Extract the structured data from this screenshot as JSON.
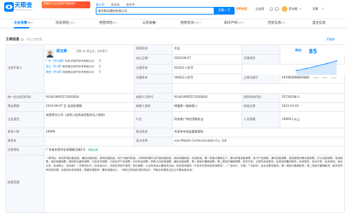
{
  "header": {
    "logo_text": "天眼查",
    "logo_url": "TianYanCha.com",
    "banner_text": "国家中小企业发展子基金旗下",
    "search_tabs": [
      "查公司",
      "查老板",
      "查关系"
    ],
    "search_value": "维沃移动通信有限公司",
    "search_button": "天眼一下",
    "vip_label": "VIP会员",
    "enterprise_label": "企业版",
    "user_name": "西瓜橙",
    "more_label": "天眼",
    "colors": {
      "brand": "#0084ff",
      "vip": "#ff7a00",
      "banner": "#ff5a30"
    }
  },
  "nav": {
    "tabs": [
      {
        "label": "企业背景",
        "count": "99+"
      },
      {
        "label": "司法风险",
        "count": "999+"
      },
      {
        "label": "经营风险",
        "count": "99+"
      },
      {
        "label": "公司发展",
        "count": "7"
      },
      {
        "label": "经营状况",
        "count": "999+"
      },
      {
        "label": "知识产权",
        "count": "999+"
      },
      {
        "label": "历史信息",
        "count": "99+"
      },
      {
        "label": "自主信息",
        "count": ""
      }
    ],
    "active_index": 0
  },
  "section": {
    "title": "工商信息",
    "subtitle": "历史工商信息",
    "right_label": "天眼查"
  },
  "legal_rep": {
    "label": "法定代表人",
    "name": "胡玉荣",
    "info": "任职 58 家企业，分布如下",
    "regions": [
      {
        "tag": "广东（共58家）",
        "text": "广东科讯软件技术有限公司",
        "more": "等"
      },
      {
        "tag": "浙江（共1家）",
        "text": "南京维沃软件技术有限公司",
        "more": "等"
      },
      {
        "tag": "其他（共4家）",
        "text": "西安维沃软件技术有限公司",
        "more": "等"
      }
    ]
  },
  "score": {
    "label": "评分",
    "value": "85",
    "years": [
      "2018",
      "2019",
      "2020",
      "2021",
      "2022"
    ],
    "trend": [
      61,
      66,
      72,
      78,
      85
    ]
  },
  "fields": {
    "status_label": "经营状态",
    "status_value": "开业",
    "established_label": "成立日期",
    "established_value": "2010-06-07",
    "reg_capital_label": "注册资本",
    "reg_capital_value": "6220万人民币",
    "paid_capital_label": "实缴资本",
    "paid_capital_value": "5000万人民币",
    "risk_label": "天眼风险",
    "risk_value": "",
    "reg_no_label": "工商注册号",
    "reg_no_value": "441900000826845",
    "credit_code_label": "统一社会信用代码",
    "credit_code_value": "91441900557262083U",
    "taxpayer_id_label": "纳税人识别号",
    "taxpayer_id_value": "91441900557262083U",
    "org_code_label": "组织机构代码",
    "org_code_value": "55726208-3",
    "term_label": "营业期限",
    "term_value": "2010-06-07 至 无固定期限",
    "taxpayer_qual_label": "纳税人资质",
    "taxpayer_qual_value": "增值税一般纳税人",
    "approved_label": "核准日期",
    "approved_value": "2023-01-03",
    "type_label": "企业类型",
    "type_value": "有限责任公司（自然人投资或控股的法人独资）",
    "industry_label": "行业",
    "industry_value": "科技推广和应用服务业",
    "staff_label": "人员规模",
    "staff_value": "10000人以上",
    "insured_label": "参保人数",
    "insured_value": "19099",
    "authority_label": "登记机关",
    "authority_value": "东莞市市场监督管理局",
    "former_name_label": "曾用名",
    "former_name_value": "-",
    "english_label": "英文名称",
    "english_value": "vivo Mobile Communication Co., Ltd",
    "address_label": "注册地址",
    "address_value": "广东省东莞市长安镇维沃路1号",
    "address_badge": "附近公司",
    "scope_label": "经营范围",
    "scope_value": "一般项目：移动终端设备制造；通信设备制造；音响设备制造；电子元器件制造；计算机软硬件及外围设备制造；家用电器制造；电池制造；第一类医疗器械生产；移动终端设备销售；电子产品销售；通讯设备销售；智能家庭消费设备销售；办公设备销售；电池销售；家用电器销售；照相机及器材销售；日用百货销售；日用化学产品销售；针纺织品销售；厨具卫浴用具销售；通信设备销售；第一类医疗器械销售；第二类医疗器械销售；软件开发；计算机系统服务；信息系统集成服务；技术服务、技术开发、技术咨询、技术交流、技术转让、技术推广；货物进出口；技术进出口；非居住房地产租赁；物业管理；以自有资金从事投资活动；信息咨询服务（不含许可类信息咨询服务）；广告设计、代理；广告制作；会议及展览服务；第一类医疗器械租赁；第二类医疗器械租赁；医学研究和试验发展；信息技术咨询服务；数据处理服务；集成电路设计。（除依法须经批准的项目外，凭营业执照依法自主开展经营活动）"
  }
}
